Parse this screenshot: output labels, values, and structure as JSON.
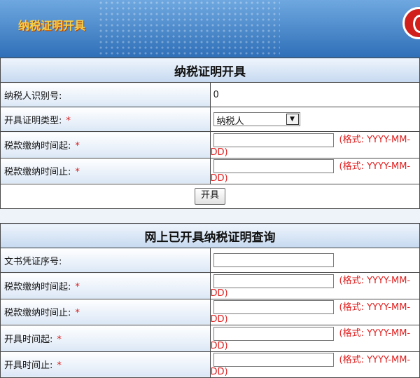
{
  "banner": {
    "title": "纳税证明开具"
  },
  "issue": {
    "heading": "纳税证明开具",
    "taxpayer_id": {
      "label": "纳税人识别号:",
      "value": "0"
    },
    "cert_type": {
      "label": "开具证明类型:",
      "required": "*",
      "selected": "纳税人"
    },
    "pay_start": {
      "label": "税款缴纳时间起:",
      "required": "*",
      "value": "",
      "format": "(格式: YYYY-MM-DD)"
    },
    "pay_end": {
      "label": "税款缴纳时间止:",
      "required": "*",
      "value": "",
      "format": "(格式: YYYY-MM-DD)"
    },
    "submit_label": "开具"
  },
  "query": {
    "heading": "网上已开具纳税证明查询",
    "doc_no": {
      "label": "文书凭证序号:",
      "value": ""
    },
    "pay_start": {
      "label": "税款缴纳时间起:",
      "required": "*",
      "value": "",
      "format": "(格式: YYYY-MM-DD)"
    },
    "pay_end": {
      "label": "税款缴纳时间止:",
      "required": "*",
      "value": "",
      "format": "(格式: YYYY-MM-DD)"
    },
    "open_start": {
      "label": "开具时间起:",
      "required": "*",
      "value": "",
      "format": "(格式: YYYY-MM-DD)"
    },
    "open_end": {
      "label": "开具时间止:",
      "required": "*",
      "value": "",
      "format": "(格式: YYYY-MM-DD)"
    }
  },
  "colors": {
    "required": "#d62020",
    "format": "#e02020",
    "banner": "#2f6fb8"
  },
  "icons": {
    "logo": "tax-logo-icon",
    "dropdown": "chevron-down-icon"
  }
}
